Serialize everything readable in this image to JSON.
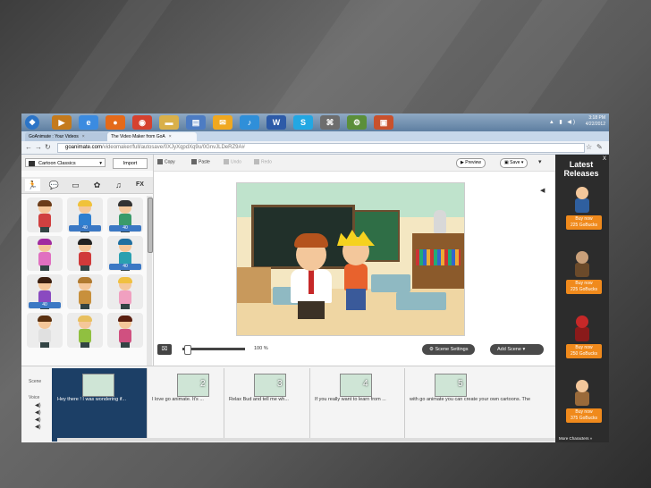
{
  "taskbar": {
    "apps": [
      {
        "icon": "windows-start-icon",
        "color": "#2b74c7"
      },
      {
        "icon": "media-player-icon",
        "color": "#c47a1d"
      },
      {
        "icon": "internet-explorer-icon",
        "color": "#3b8be0"
      },
      {
        "icon": "firefox-icon",
        "color": "#e46a1a"
      },
      {
        "icon": "chrome-icon",
        "color": "#d5412f"
      },
      {
        "icon": "folder-icon",
        "color": "#d9b04a"
      },
      {
        "icon": "document-icon",
        "color": "#4d7cc3"
      },
      {
        "icon": "mail-icon",
        "color": "#f0a820"
      },
      {
        "icon": "itunes-icon",
        "color": "#2f8fd9"
      },
      {
        "icon": "word-icon",
        "color": "#2d5ba8"
      },
      {
        "icon": "skype-icon",
        "color": "#22a7e3"
      },
      {
        "icon": "network-icon",
        "color": "#6d6d6d"
      },
      {
        "icon": "settings-icon",
        "color": "#5b8f3a"
      },
      {
        "icon": "presentation-icon",
        "color": "#c8512d"
      }
    ],
    "clock_time": "3:18 PM",
    "clock_date": "4/22/2012"
  },
  "browser": {
    "tabs": [
      {
        "label": "GoAnimate : Your Videos",
        "active": false
      },
      {
        "label": "The Video Maker from GoA",
        "active": true
      }
    ],
    "url_domain": "goanimate.com",
    "url_path": "/videomaker/full/autosave/0XJyXqpdXq9u/0GnvJLDeRZ9A#"
  },
  "editor": {
    "category_select": "Cartoon Classics",
    "import_label": "Import",
    "copy_label": "Copy",
    "paste_label": "Paste",
    "undo_label": "Undo",
    "redo_label": "Redo",
    "preview_label": "Preview",
    "save_label": "Save",
    "category_tabs": [
      {
        "icon": "character-icon",
        "label": "🏃"
      },
      {
        "icon": "speech-bubble-icon",
        "label": "💬"
      },
      {
        "icon": "backdrop-icon",
        "label": "▭"
      },
      {
        "icon": "prop-icon",
        "label": "✿"
      },
      {
        "icon": "music-icon",
        "label": "♫"
      },
      {
        "icon": "effects-icon",
        "label": "FX"
      }
    ],
    "characters": [
      {
        "hair": "#6b3c1a",
        "shirt": "#d04040",
        "badge": ""
      },
      {
        "hair": "#f0c23a",
        "shirt": "#2f7fd0",
        "badge": "40"
      },
      {
        "hair": "#333333",
        "shirt": "#3a9a6a",
        "badge": "40"
      },
      {
        "hair": "#a02ca0",
        "shirt": "#e070c0",
        "badge": ""
      },
      {
        "hair": "#222222",
        "shirt": "#d03a3a",
        "badge": ""
      },
      {
        "hair": "#1f6fa0",
        "shirt": "#2aa0b0",
        "badge": "40"
      },
      {
        "hair": "#3b1f10",
        "shirt": "#8a4ac0",
        "badge": "40"
      },
      {
        "hair": "#b07a30",
        "shirt": "#c8903c",
        "badge": ""
      },
      {
        "hair": "#f0c040",
        "shirt": "#f0a0c0",
        "badge": ""
      },
      {
        "hair": "#5a3010",
        "shirt": "#e0e0e0",
        "badge": ""
      },
      {
        "hair": "#e8c060",
        "shirt": "#90c040",
        "badge": ""
      },
      {
        "hair": "#5a1f10",
        "shirt": "#d05080",
        "badge": ""
      }
    ],
    "zoom_level": "100 %",
    "scene_settings_label": "Scene Settings",
    "add_scene_label": "Add Scene"
  },
  "timeline": {
    "scene_label": "Scene",
    "voice_label": "Voice",
    "scenes": [
      {
        "number": "",
        "voice": "Hey there ! I was wondering if...",
        "active": true
      },
      {
        "number": "2",
        "voice": "I love  go animate. It's ...",
        "active": false
      },
      {
        "number": "3",
        "voice": "Relax Bud and tell me wh...",
        "active": false
      },
      {
        "number": "4",
        "voice": "If you really want to learn from ...",
        "active": false
      },
      {
        "number": "5",
        "voice": "with go animate you can create your own cartoons. The",
        "active": false
      }
    ]
  },
  "sidebar": {
    "close_label": "X",
    "title": "Latest Releases",
    "promos": [
      {
        "buy": "Buy now",
        "price": "225 GoBucks",
        "head": "#f3c79b",
        "body": "#2f5f9f"
      },
      {
        "buy": "Buy now",
        "price": "225 GoBucks",
        "head": "#c9a07a",
        "body": "#6b4a2a"
      },
      {
        "buy": "Buy now",
        "price": "250 GoBucks",
        "head": "#c62828",
        "body": "#8a1a1a"
      },
      {
        "buy": "Buy now",
        "price": "375 GoBucks",
        "head": "#f3c79b",
        "body": "#9a6a3a"
      }
    ],
    "more_label": "More Characters »"
  }
}
